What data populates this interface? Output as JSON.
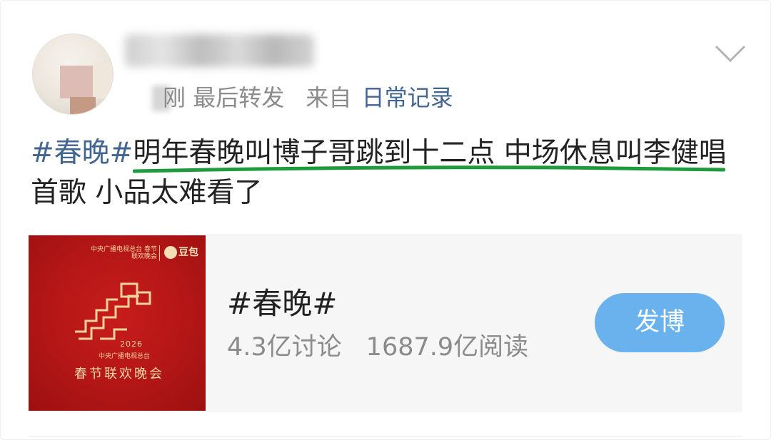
{
  "post": {
    "meta": {
      "time": "刚",
      "action": "最后转发",
      "from_label": "来自",
      "source": "日常记录"
    },
    "text": {
      "hashtag": "#春晚#",
      "body": "明年春晚叫博子哥跳到十二点 中场休息叫李健唱首歌 小品太难看了"
    }
  },
  "topic": {
    "name": "#春晚#",
    "discussions": "4.3亿讨论",
    "reads": "1687.9亿阅读",
    "button_label": "发博",
    "thumbnail": {
      "logo_text": "中央广播电视总台 春节联欢晚会",
      "doubao": "豆包",
      "year": "2026",
      "subtitle": "中央广播电视总台",
      "title": "春节联欢晚会"
    }
  },
  "icons": {
    "chevron": "chevron-down-icon",
    "avatar": "avatar"
  },
  "colors": {
    "link_blue": "#436591",
    "button_blue": "#69b2ee",
    "meta_gray": "#8b8b8b",
    "highlight_green": "#1f9a3c",
    "thumb_red": "#b31616"
  }
}
